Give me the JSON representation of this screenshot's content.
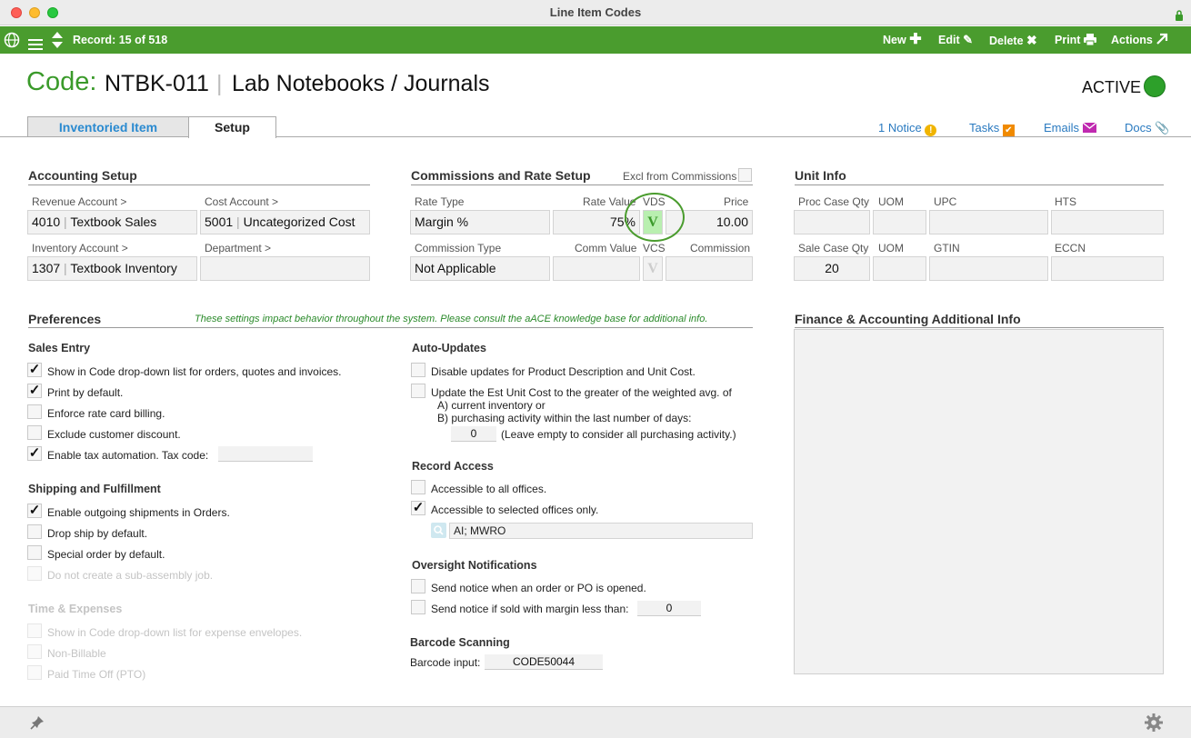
{
  "window": {
    "title": "Line Item Codes"
  },
  "toolbar": {
    "record": "Record: 15 of 518",
    "new_label": "New",
    "edit_label": "Edit",
    "delete_label": "Delete",
    "print_label": "Print",
    "actions_label": "Actions"
  },
  "header": {
    "code_label": "Code:",
    "code": "NTBK-011",
    "separator": "|",
    "name": "Lab Notebooks / Journals",
    "status": "ACTIVE",
    "status_color": "#2da02a"
  },
  "tabs": [
    {
      "label": "Inventoried Item",
      "active": false
    },
    {
      "label": "Setup",
      "active": true
    }
  ],
  "header_links": {
    "notice": "1 Notice",
    "tasks": "Tasks",
    "emails": "Emails",
    "docs": "Docs"
  },
  "accounting": {
    "title": "Accounting Setup",
    "revenue_label": "Revenue Account >",
    "revenue_code": "4010",
    "revenue_name": "Textbook Sales",
    "cost_label": "Cost Account >",
    "cost_code": "5001",
    "cost_name": "Uncategorized Cost",
    "inventory_label": "Inventory Account >",
    "inventory_code": "1307",
    "inventory_name": "Textbook Inventory",
    "department_label": "Department >",
    "department_value": "",
    "sep": "|"
  },
  "commissions": {
    "title": "Commissions and Rate Setup",
    "excl_label": "Excl from Commissions",
    "rate_type_label": "Rate Type",
    "rate_type": "Margin %",
    "rate_value_label": "Rate Value",
    "rate_value": "75%",
    "vds_label": "VDS",
    "vds_value": "V",
    "price_label": "Price",
    "price": "10.00",
    "commission_type_label": "Commission Type",
    "commission_type": "Not Applicable",
    "comm_value_label": "Comm Value",
    "vcs_label": "VCS",
    "vcs_value": "V",
    "commission_label": "Commission"
  },
  "unit_info": {
    "title": "Unit Info",
    "proc_case_qty_label": "Proc Case Qty",
    "uom_label": "UOM",
    "upc_label": "UPC",
    "hts_label": "HTS",
    "sale_case_qty_label": "Sale Case Qty",
    "sale_case_qty": "20",
    "uom2_label": "UOM",
    "gtin_label": "GTIN",
    "eccn_label": "ECCN"
  },
  "preferences": {
    "title": "Preferences",
    "note": "These settings impact behavior throughout the system. Please consult the aACE knowledge base for additional info.",
    "sales_entry": {
      "title": "Sales Entry",
      "items": [
        {
          "label": "Show in Code drop-down list for orders, quotes and invoices.",
          "checked": true
        },
        {
          "label": "Print by default.",
          "checked": true
        },
        {
          "label": "Enforce rate card billing.",
          "checked": false
        },
        {
          "label": "Exclude customer discount.",
          "checked": false
        },
        {
          "label": "Enable tax automation. Tax code:",
          "checked": true
        }
      ],
      "tax_code": ""
    },
    "shipping": {
      "title": "Shipping and Fulfillment",
      "items": [
        {
          "label": "Enable outgoing shipments in Orders.",
          "checked": true
        },
        {
          "label": "Drop ship by default.",
          "checked": false
        },
        {
          "label": "Special order by default.",
          "checked": false
        },
        {
          "label": "Do not create a sub-assembly job.",
          "checked": false
        }
      ]
    },
    "time_expenses": {
      "title": "Time & Expenses",
      "items": [
        {
          "label": "Show in Code drop-down list for expense envelopes.",
          "checked": false
        },
        {
          "label": "Non-Billable",
          "checked": false
        },
        {
          "label": "Paid Time Off (PTO)",
          "checked": false
        }
      ]
    },
    "auto_updates": {
      "title": "Auto-Updates",
      "disable_label": "Disable updates for Product Description and Unit Cost.",
      "update_label": "Update the Est Unit Cost to the greater of the weighted avg. of",
      "option_a": "A) current inventory or",
      "option_b": "B) purchasing activity within the last number of days:",
      "days": "0",
      "days_note": "(Leave empty to consider all purchasing activity.)"
    },
    "record_access": {
      "title": "Record Access",
      "all_label": "Accessible to all offices.",
      "selected_label": "Accessible to selected offices only.",
      "offices": "AI; MWRO"
    },
    "oversight": {
      "title": "Oversight Notifications",
      "opened_label": "Send notice when an order or PO is opened.",
      "margin_label": "Send notice if sold with margin less than:",
      "margin_value": "0"
    },
    "barcode": {
      "title": "Barcode Scanning",
      "input_label": "Barcode input:",
      "input_value": "CODE50044"
    }
  },
  "finance": {
    "title": "Finance & Accounting Additional Info"
  },
  "colors": {
    "toolbar": "#4a9c2e",
    "accent_green": "#3a9a2a",
    "link_blue": "#2a7ac0"
  }
}
